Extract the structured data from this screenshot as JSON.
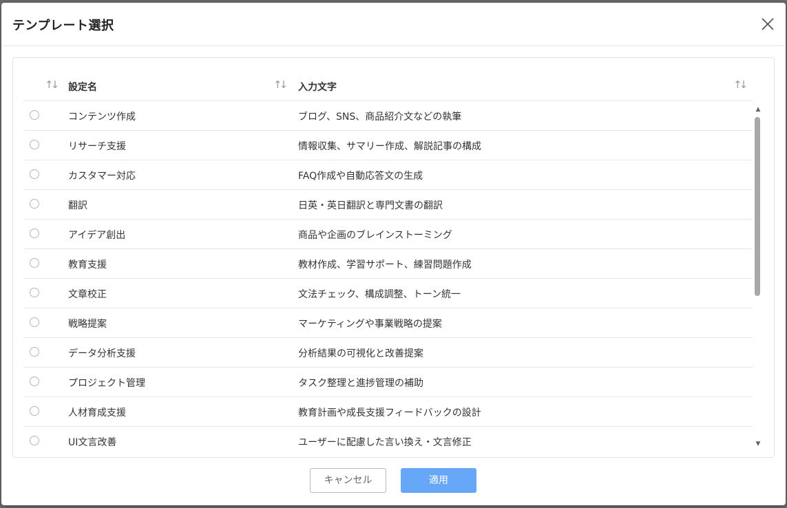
{
  "dialog": {
    "title": "テンプレート選択",
    "close_icon": "close-icon"
  },
  "table": {
    "columns": [
      {
        "label": "設定名",
        "sort_icon": "sort-icon"
      },
      {
        "label": "入力文字",
        "sort_icon": "sort-icon"
      }
    ],
    "rows": [
      {
        "name": "コンテンツ作成",
        "text": "ブログ、SNS、商品紹介文などの執筆"
      },
      {
        "name": "リサーチ支援",
        "text": "情報収集、サマリー作成、解説記事の構成"
      },
      {
        "name": "カスタマー対応",
        "text": "FAQ作成や自動応答文の生成"
      },
      {
        "name": "翻訳",
        "text": "日英・英日翻訳と専門文書の翻訳"
      },
      {
        "name": "アイデア創出",
        "text": "商品や企画のブレインストーミング"
      },
      {
        "name": "教育支援",
        "text": "教材作成、学習サポート、練習問題作成"
      },
      {
        "name": "文章校正",
        "text": "文法チェック、構成調整、トーン統一"
      },
      {
        "name": "戦略提案",
        "text": "マーケティングや事業戦略の提案"
      },
      {
        "name": "データ分析支援",
        "text": "分析結果の可視化と改善提案"
      },
      {
        "name": "プロジェクト管理",
        "text": "タスク整理と進捗管理の補助"
      },
      {
        "name": "人材育成支援",
        "text": "教育計画や成長支援フィードバックの設計"
      },
      {
        "name": "UI文言改善",
        "text": "ユーザーに配慮した言い換え・文言修正"
      }
    ]
  },
  "footer": {
    "cancel_label": "キャンセル",
    "apply_label": "適用"
  },
  "colors": {
    "accent": "#66a8f7",
    "border": "#e6e6e6"
  }
}
